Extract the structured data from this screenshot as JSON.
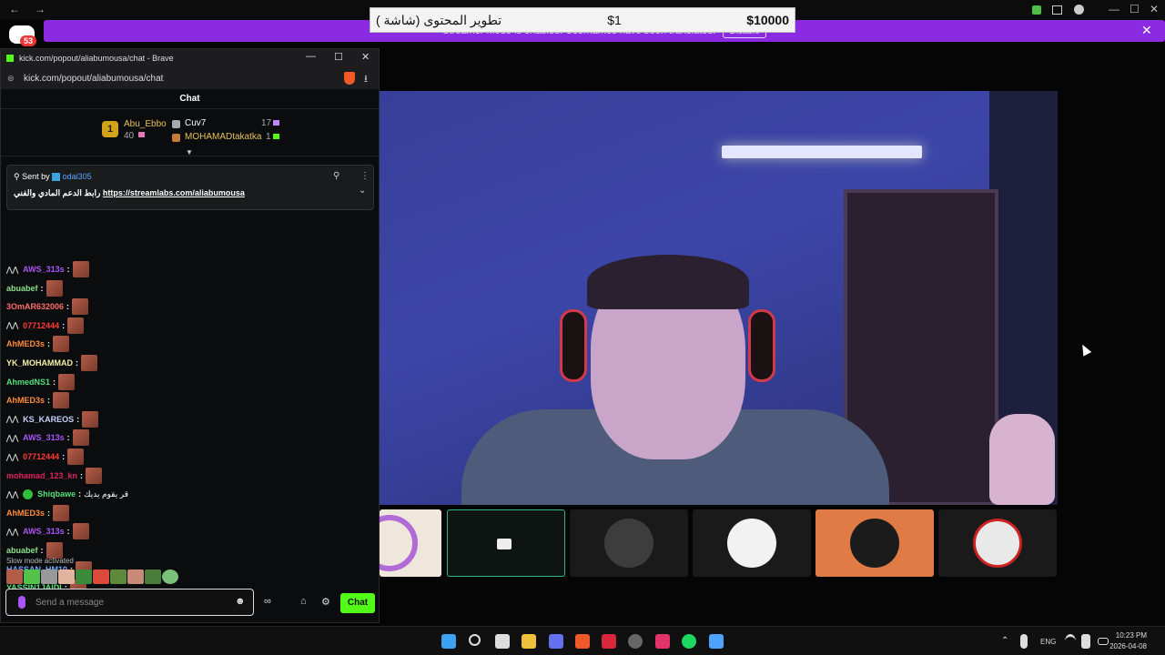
{
  "top": {
    "back": "←",
    "forward": "→",
    "banner_text": "Streamer Mode is enabled. Usernames have been translated.",
    "banner_button": "Disable",
    "banner_close": "✕",
    "discord_badge": "53"
  },
  "donation": {
    "message": "تطوير المحتوى (شاشة )",
    "amount_small": "$1",
    "amount_large": "$10000"
  },
  "browser": {
    "title": "kick.com/popout/aliabumousa/chat - Brave",
    "url": "kick.com/popout/aliabumousa/chat",
    "minimize": "—",
    "maximize": "☐",
    "close": "✕",
    "download_icon": "⭳"
  },
  "chat": {
    "header": "Chat",
    "leaderboard": {
      "first": {
        "rank": "1",
        "name": "Abu_Ebbo",
        "count": "40"
      },
      "second": {
        "name": "Cuv7",
        "count": "17"
      },
      "third": {
        "name": "MOHAMADtakatka",
        "count": "1"
      },
      "expand": "▼"
    },
    "pinned": {
      "sent_by_label": "Sent by",
      "sender": "odai305",
      "text": "رابط الدعم المادي والفني",
      "link": "https://streamlabs.com/aliabumousa",
      "pin": "⚲",
      "more": "⋮",
      "collapse": "⌄"
    },
    "messages": [
      {
        "user": "AWS_313s",
        "color": "#a855f7",
        "badge": "⋀⋀",
        "text": ""
      },
      {
        "user": "abuabef",
        "color": "#8be38b",
        "badge": "",
        "text": ""
      },
      {
        "user": "3OmAR632006",
        "color": "#ff6b6b",
        "badge": "",
        "text": ""
      },
      {
        "user": "07712444",
        "color": "#ff3b3b",
        "badge": "⋀⋀",
        "text": ""
      },
      {
        "user": "AhMED3s",
        "color": "#ff8c3b",
        "badge": "",
        "text": ""
      },
      {
        "user": "YK_MOHAMMAD",
        "color": "#f5f0a8",
        "badge": "",
        "text": ""
      },
      {
        "user": "AhmedNS1",
        "color": "#53e07a",
        "badge": "",
        "text": ""
      },
      {
        "user": "AhMED3s",
        "color": "#ff8c3b",
        "badge": "",
        "text": ""
      },
      {
        "user": "KS_KAREOS",
        "color": "#c8d0ff",
        "badge": "⋀⋀",
        "text": ""
      },
      {
        "user": "AWS_313s",
        "color": "#a855f7",
        "badge": "⋀⋀",
        "text": ""
      },
      {
        "user": "07712444",
        "color": "#ff3b3b",
        "badge": "⋀⋀",
        "text": ""
      },
      {
        "user": "mohamad_123_kn",
        "color": "#e0245e",
        "badge": "",
        "text": ""
      },
      {
        "user": "Shiqbawe",
        "color": "#53e07a",
        "badge": "⋀⋀",
        "text": "قر يقوم يديك"
      },
      {
        "user": "AhMED3s",
        "color": "#ff8c3b",
        "badge": "",
        "text": ""
      },
      {
        "user": "AWS_313s",
        "color": "#a855f7",
        "badge": "⋀⋀",
        "text": ""
      },
      {
        "user": "abuabef",
        "color": "#8be38b",
        "badge": "",
        "text": ""
      },
      {
        "user": "HASSAN_HM10",
        "color": "#6fa8ff",
        "badge": "",
        "text": ""
      },
      {
        "user": "YASSIN1JAIDI",
        "color": "#53e07a",
        "badge": "",
        "text": ""
      }
    ],
    "slow_mode": "Slow mode activated",
    "input_placeholder": "Send a message",
    "send_label": "Chat",
    "emoji_icon": "☻",
    "settings_icon": "⚙",
    "store_icon": "⌂",
    "share_icon": "∞"
  },
  "taskbar": {
    "lang": "ENG",
    "time": "10:23 PM",
    "date": "2026-04-08",
    "up_arrow": "⌃"
  },
  "colors": {
    "kick_green": "#53fc18",
    "purple": "#8a2be2",
    "leader_gold": "#d4a21a"
  }
}
